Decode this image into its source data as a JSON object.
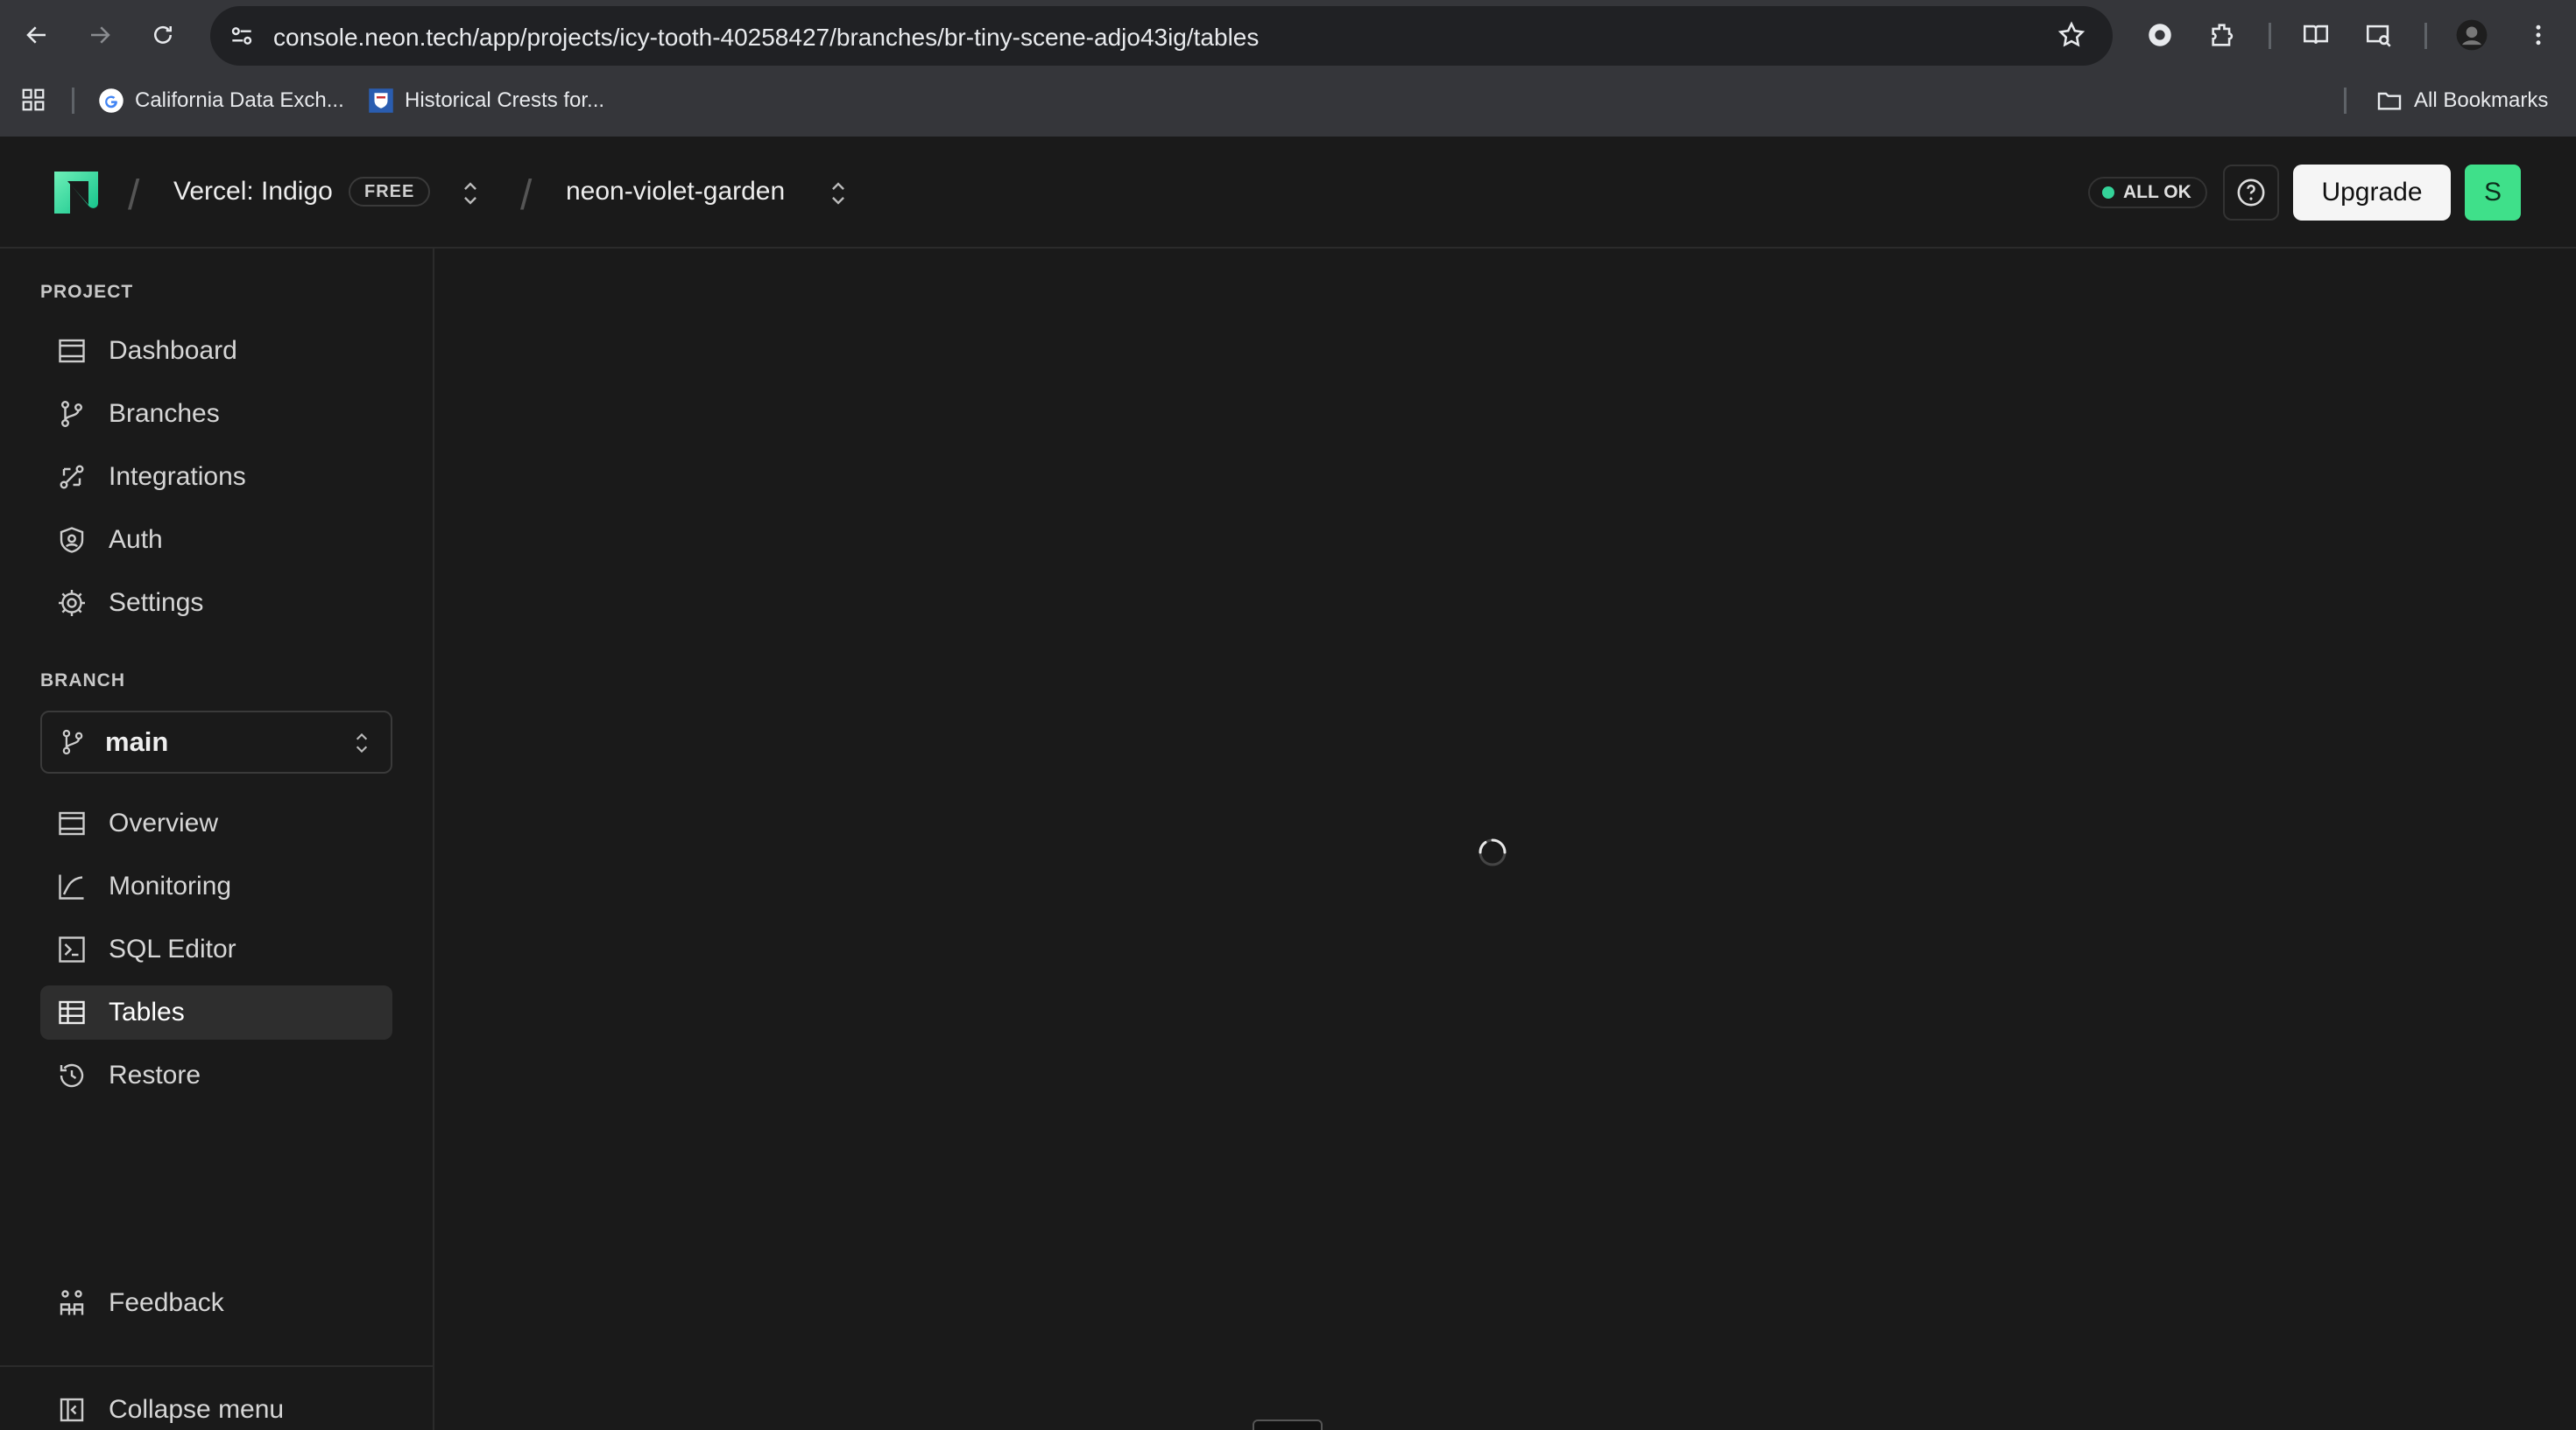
{
  "browser": {
    "url": "console.neon.tech/app/projects/icy-tooth-40258427/branches/br-tiny-scene-adjo43ig/tables",
    "bookmarks": [
      {
        "label": "California Data Exch...",
        "icon": "google-icon"
      },
      {
        "label": "Historical Crests for...",
        "icon": "crest-icon"
      }
    ],
    "all_bookmarks": "All Bookmarks"
  },
  "header": {
    "org_name": "Vercel: Indigo",
    "plan_badge": "FREE",
    "project_name": "neon-violet-garden",
    "status": "ALL OK",
    "upgrade_label": "Upgrade",
    "avatar_initial": "S",
    "colors": {
      "accent": "#3fe08a",
      "status_ok": "#34d399"
    }
  },
  "sidebar": {
    "project_label": "PROJECT",
    "project_items": [
      {
        "label": "Dashboard",
        "icon": "dashboard-icon"
      },
      {
        "label": "Branches",
        "icon": "branch-icon"
      },
      {
        "label": "Integrations",
        "icon": "integrations-icon"
      },
      {
        "label": "Auth",
        "icon": "auth-icon"
      },
      {
        "label": "Settings",
        "icon": "gear-icon"
      }
    ],
    "branch_label": "BRANCH",
    "branch_selected": "main",
    "branch_items": [
      {
        "label": "Overview",
        "icon": "overview-icon"
      },
      {
        "label": "Monitoring",
        "icon": "monitoring-icon"
      },
      {
        "label": "SQL Editor",
        "icon": "sql-editor-icon"
      },
      {
        "label": "Tables",
        "icon": "tables-icon",
        "active": true
      },
      {
        "label": "Restore",
        "icon": "restore-icon"
      }
    ],
    "feedback_label": "Feedback",
    "collapse_label": "Collapse menu"
  }
}
